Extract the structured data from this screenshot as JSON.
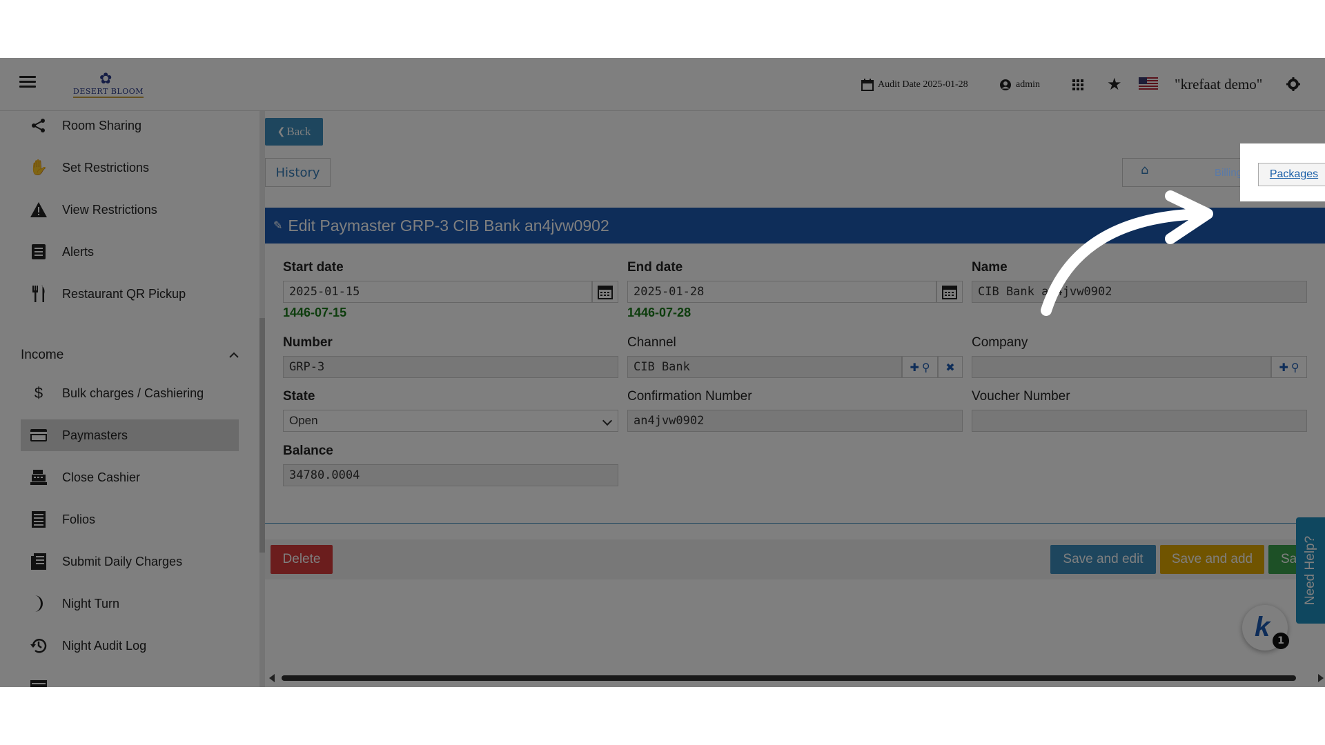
{
  "topbar": {
    "logo_text": "DESERT BLOOM",
    "audit_date": "Audit Date 2025-01-28",
    "user": "admin",
    "demo_name": "\"krefaat demo\"",
    "icons": [
      "hamburger-icon",
      "calendar-icon",
      "user-circle-icon",
      "apps-grid-icon",
      "star-icon",
      "us-flag-icon",
      "gear-icon"
    ]
  },
  "sidebar": {
    "items_top": [
      {
        "label": "Room Sharing",
        "icon": "share-icon"
      },
      {
        "label": "Set Restrictions",
        "icon": "hand-icon"
      },
      {
        "label": "View Restrictions",
        "icon": "warning-icon"
      },
      {
        "label": "Alerts",
        "icon": "list-icon"
      },
      {
        "label": "Restaurant QR Pickup",
        "icon": "utensils-icon"
      }
    ],
    "section": "Income",
    "items_income": [
      {
        "label": "Bulk charges / Cashiering",
        "icon": "dollar-icon"
      },
      {
        "label": "Paymasters",
        "icon": "credit-card-icon",
        "active": true
      },
      {
        "label": "Close Cashier",
        "icon": "cash-register-icon"
      },
      {
        "label": "Folios",
        "icon": "folio-icon"
      },
      {
        "label": "Submit Daily Charges",
        "icon": "receipt-icon"
      },
      {
        "label": "Night Turn",
        "icon": "moon-icon"
      },
      {
        "label": "Night Audit Log",
        "icon": "history-icon"
      }
    ]
  },
  "main": {
    "back_label": "Back",
    "history_tab": "History",
    "billing_tab": "Billing",
    "packages_tab": "Packages",
    "panel_title": "Edit Paymaster GRP-3 CIB Bank an4jvw0902",
    "form": {
      "start_date_label": "Start date",
      "start_date": "2025-01-15",
      "start_hijri": "1446-07-15",
      "end_date_label": "End date",
      "end_date": "2025-01-28",
      "end_hijri": "1446-07-28",
      "name_label": "Name",
      "name": "CIB Bank an4jvw0902",
      "number_label": "Number",
      "number": "GRP-3",
      "channel_label": "Channel",
      "channel": "CIB Bank",
      "company_label": "Company",
      "company": "",
      "state_label": "State",
      "state": "Open",
      "confirmation_label": "Confirmation Number",
      "confirmation": "an4jvw0902",
      "voucher_label": "Voucher Number",
      "voucher": "",
      "balance_label": "Balance",
      "balance": "34780.0004"
    },
    "actions": {
      "delete": "Delete",
      "save_edit": "Save and edit",
      "save_add": "Save and add",
      "save": "Save"
    },
    "need_help": "Need Help?",
    "badge_count": "1"
  },
  "colors": {
    "primary_blue": "#1c5bb2",
    "link_blue": "#3c8dbc",
    "delete_red": "#d63b3b",
    "save_add_yellow": "#e0a800",
    "save_green": "#3aa04c",
    "hijri_green": "#1a7a1a",
    "overlay": "rgba(0,0,0,0.5)"
  }
}
